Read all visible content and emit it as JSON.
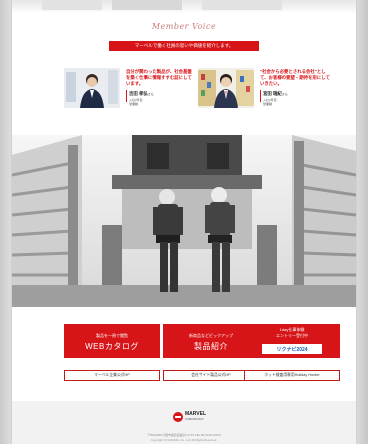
{
  "section": {
    "script_title": "Member Voice",
    "banner": "マーベルで働く社員の思いや価値を紹介します。"
  },
  "members": [
    {
      "quote": "自分が関わった製品が、社会基盤を築く仕事に情報すすむ証にしています。",
      "name": "吉田 孝弘",
      "suffix": "さん",
      "meta1": "入社2年目",
      "meta2": "営業職"
    },
    {
      "quote": "\"社会から必要とされる会社\"として、お客様の要望・期待を形にしていきたい。",
      "name": "宮田 瑞紀",
      "suffix": "さん",
      "meta1": "入社3年目",
      "meta2": "営業職"
    }
  ],
  "cta": [
    {
      "small": "製品を一冊で閲覧",
      "large": "WEBカタログ"
    },
    {
      "small": "新商品などピックアップ",
      "large": "製品紹介"
    },
    {
      "small": "1day仕事体験",
      "small2": "エントリー受付中",
      "large": "リクナビ2024"
    }
  ],
  "links": [
    "マーベル企業公式HP",
    "会社サイト製品公式HP",
    "ホット検査用専用Holiday Hunter"
  ],
  "footer": {
    "logo": "MARVEL",
    "logo_sub": "CORPORATION",
    "address": "〒553-0003 大阪市福島区福島X-X-XX TEL.06-XXXX-XXXX",
    "copyright": "Copyright (C) MARVEL Co., Ltd. All Rights Reserved."
  },
  "colors": {
    "accent": "#d71518",
    "script": "#c97c7c"
  }
}
